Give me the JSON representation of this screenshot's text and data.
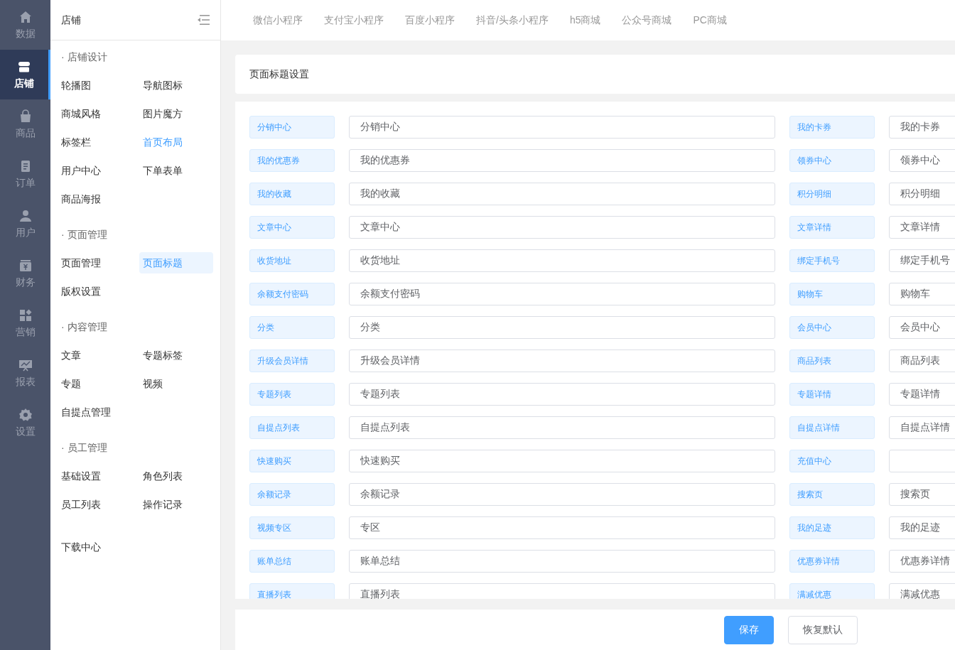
{
  "nav_rail": [
    {
      "label": "数据",
      "kind": "home",
      "selected": false
    },
    {
      "label": "店铺",
      "kind": "store",
      "selected": true
    },
    {
      "label": "商品",
      "kind": "bag",
      "selected": false
    },
    {
      "label": "订单",
      "kind": "doc",
      "selected": false
    },
    {
      "label": "用户",
      "kind": "user",
      "selected": false
    },
    {
      "label": "财务",
      "kind": "money",
      "selected": false
    },
    {
      "label": "营销",
      "kind": "grid",
      "selected": false
    },
    {
      "label": "报表",
      "kind": "chart",
      "selected": false
    },
    {
      "label": "设置",
      "kind": "gear",
      "selected": false
    }
  ],
  "submenu": {
    "title": "店铺",
    "groups": [
      {
        "title": "· 店铺设计",
        "items": [
          {
            "label": "轮播图",
            "selected": false,
            "hovered": false
          },
          {
            "label": "导航图标",
            "selected": false,
            "hovered": false
          },
          {
            "label": "商城风格",
            "selected": false,
            "hovered": false
          },
          {
            "label": "图片魔方",
            "selected": false,
            "hovered": false
          },
          {
            "label": "标签栏",
            "selected": false,
            "hovered": false
          },
          {
            "label": "首页布局",
            "selected": false,
            "hovered": true
          },
          {
            "label": "用户中心",
            "selected": false,
            "hovered": false
          },
          {
            "label": "下单表单",
            "selected": false,
            "hovered": false
          },
          {
            "label": "商品海报",
            "selected": false,
            "hovered": false
          }
        ]
      },
      {
        "title": "· 页面管理",
        "items": [
          {
            "label": "页面管理",
            "selected": false,
            "hovered": false
          },
          {
            "label": "页面标题",
            "selected": true,
            "hovered": false
          },
          {
            "label": "版权设置",
            "selected": false,
            "hovered": false
          }
        ]
      },
      {
        "title": "· 内容管理",
        "items": [
          {
            "label": "文章",
            "selected": false,
            "hovered": false
          },
          {
            "label": "专题标签",
            "selected": false,
            "hovered": false
          },
          {
            "label": "专题",
            "selected": false,
            "hovered": false
          },
          {
            "label": "视频",
            "selected": false,
            "hovered": false
          },
          {
            "label": "自提点管理",
            "selected": false,
            "hovered": false
          }
        ]
      },
      {
        "title": "· 员工管理",
        "items": [
          {
            "label": "基础设置",
            "selected": false,
            "hovered": false
          },
          {
            "label": "角色列表",
            "selected": false,
            "hovered": false
          },
          {
            "label": "员工列表",
            "selected": false,
            "hovered": false
          },
          {
            "label": "操作记录",
            "selected": false,
            "hovered": false
          }
        ]
      },
      {
        "items": [
          {
            "label": "下载中心",
            "selected": false,
            "hovered": false
          }
        ]
      }
    ]
  },
  "platform_tabs": [
    "微信小程序",
    "支付宝小程序",
    "百度小程序",
    "抖音/头条小程序",
    "h5商城",
    "公众号商城",
    "PC商城"
  ],
  "section_title": "页面标题设置",
  "rows": [
    [
      {
        "label": "分销中心",
        "value": "分销中心"
      },
      {
        "label": "我的卡券",
        "value": "我的卡券"
      }
    ],
    [
      {
        "label": "我的优惠券",
        "value": "我的优惠券"
      },
      {
        "label": "领券中心",
        "value": "领券中心"
      }
    ],
    [
      {
        "label": "我的收藏",
        "value": "我的收藏"
      },
      {
        "label": "积分明细",
        "value": "积分明细"
      }
    ],
    [
      {
        "label": "文章中心",
        "value": "文章中心"
      },
      {
        "label": "文章详情",
        "value": "文章详情"
      }
    ],
    [
      {
        "label": "收货地址",
        "value": "收货地址"
      },
      {
        "label": "绑定手机号",
        "value": "绑定手机号"
      }
    ],
    [
      {
        "label": "余额支付密码",
        "value": "余额支付密码"
      },
      {
        "label": "购物车",
        "value": "购物车"
      }
    ],
    [
      {
        "label": "分类",
        "value": "分类"
      },
      {
        "label": "会员中心",
        "value": "会员中心"
      }
    ],
    [
      {
        "label": "升级会员详情",
        "value": "升级会员详情"
      },
      {
        "label": "商品列表",
        "value": "商品列表"
      }
    ],
    [
      {
        "label": "专题列表",
        "value": "专题列表"
      },
      {
        "label": "专题详情",
        "value": "专题详情"
      }
    ],
    [
      {
        "label": "自提点列表",
        "value": "自提点列表"
      },
      {
        "label": "自提点详情",
        "value": "自提点详情"
      }
    ],
    [
      {
        "label": "快速购买",
        "value": "快速购买"
      },
      {
        "label": "充值中心"
      }
    ],
    [
      {
        "label": "余额记录",
        "value": "余额记录"
      },
      {
        "label": "搜索页",
        "value": "搜索页"
      }
    ],
    [
      {
        "label": "视频专区",
        "value": "专区"
      },
      {
        "label": "我的足迹",
        "value": "我的足迹"
      }
    ],
    [
      {
        "label": "账单总结",
        "value": "账单总结"
      },
      {
        "label": "优惠券详情",
        "value": "优惠券详情"
      }
    ],
    [
      {
        "label": "直播列表",
        "value": "直播列表"
      },
      {
        "label": "满减优惠",
        "value": "满减优惠"
      }
    ]
  ],
  "buttons": [
    {
      "label": "保存",
      "kind": "primary"
    },
    {
      "label": "恢复默认",
      "kind": "default"
    }
  ]
}
